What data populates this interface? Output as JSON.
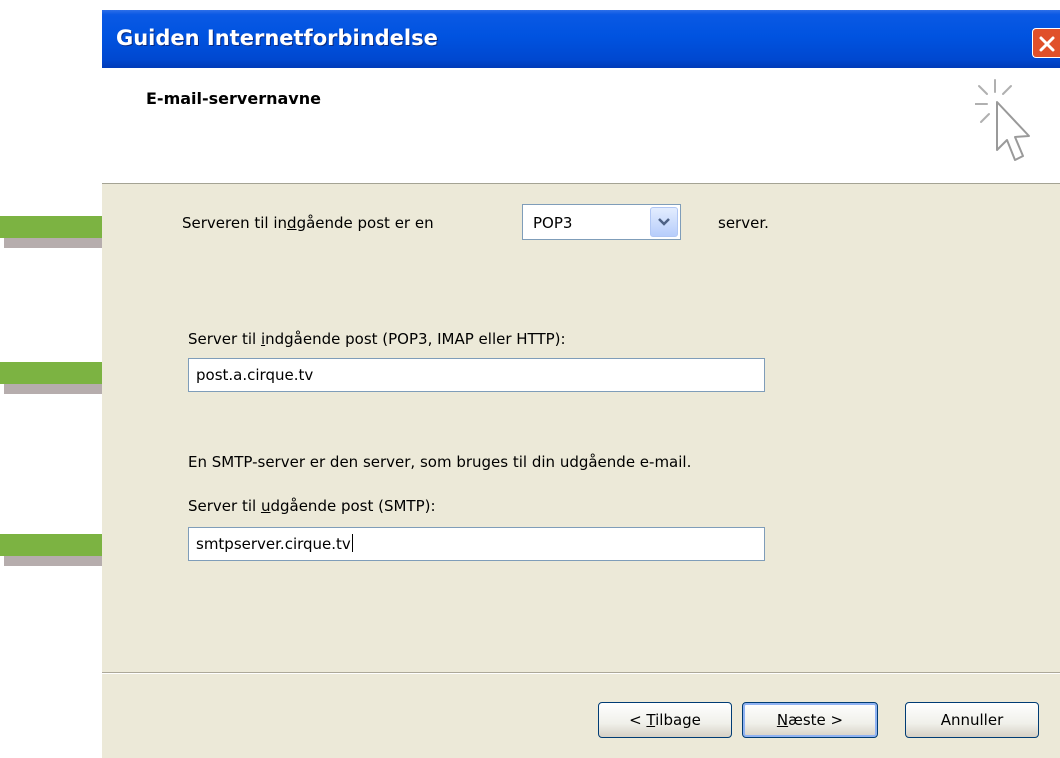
{
  "window": {
    "title": "Guiden Internetforbindelse"
  },
  "header": {
    "heading": "E-mail-servernavne"
  },
  "incoming_type": {
    "prefix_a": "Serveren til in",
    "prefix_u": "d",
    "prefix_b": "gående post er en",
    "selected": "POP3",
    "suffix": "server."
  },
  "incoming_server": {
    "label_a": "Server til ",
    "label_u": "i",
    "label_b": "ndgående post (POP3, IMAP eller HTTP):",
    "value": "post.a.cirque.tv"
  },
  "smtp_note": "En SMTP-server er den server, som bruges til din udgående e-mail.",
  "outgoing_server": {
    "label_a": "Server til ",
    "label_u": "u",
    "label_b": "dgående post (SMTP):",
    "value": "smtpserver.cirque.tv"
  },
  "buttons": {
    "back_a": "< ",
    "back_u": "T",
    "back_b": "ilbage",
    "next_u": "N",
    "next_b": "æste >",
    "cancel": "Annuller"
  },
  "colors": {
    "titlebar": "#0053e0",
    "dialog_bg": "#ece9d8",
    "annotation_arrow": "#7cb342",
    "close_button": "#e0502a"
  }
}
